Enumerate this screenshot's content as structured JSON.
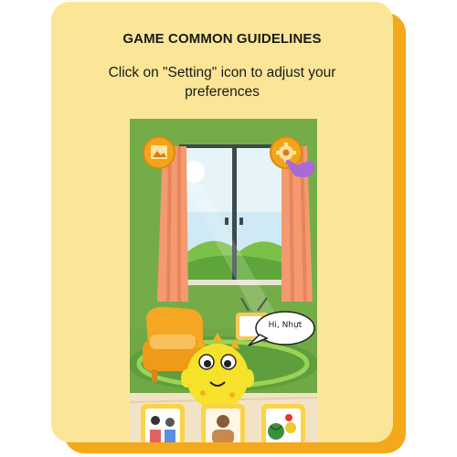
{
  "guide": {
    "title": "GAME COMMON GUIDELINES",
    "instruction": "Click on \"Setting\" icon to adjust your preferences"
  },
  "game": {
    "speech_bubble": "Hi, Nhựt",
    "top_left_button_icon": "gallery-icon",
    "top_right_button_icon": "settings-gear-icon",
    "pointer_icon": "pointing-hand-icon",
    "bottom_cards": [
      "family-photo-card",
      "person-card",
      "fruits-card"
    ]
  },
  "colors": {
    "card_background": "#fbe697",
    "card_shadow": "#f4a81c",
    "wall": "#6fa845",
    "button": "#f2a51a"
  }
}
